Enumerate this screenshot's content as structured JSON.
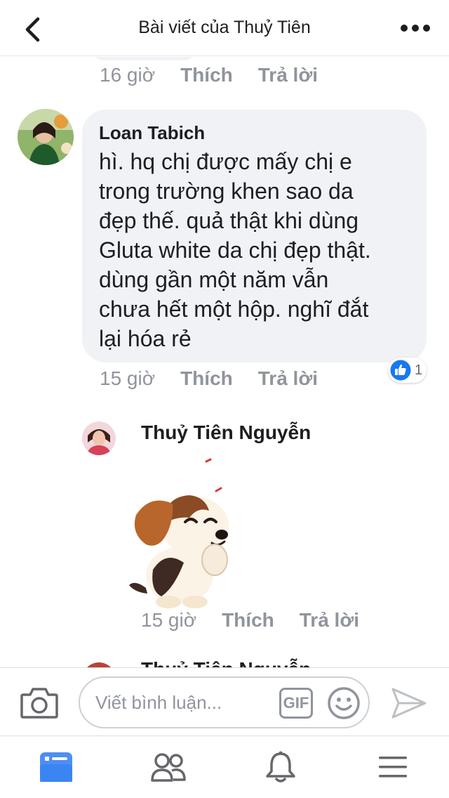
{
  "header": {
    "title": "Bài viết của Thuỷ Tiên"
  },
  "previous_comment": {
    "time": "16 giờ",
    "like_label": "Thích",
    "reply_label": "Trả lời"
  },
  "comment": {
    "author": "Loan Tabich",
    "text_lines": [
      "hì. hq chị được mấy chị e",
      "trong trường khen sao da",
      "đẹp thế. quả thật khi dùng",
      "Gluta white da chị đẹp thật.",
      "dùng gần một năm vẫn",
      "chưa hết một hộp. nghĩ đắt",
      "lại hóa rẻ"
    ],
    "time": "15 giờ",
    "like_label": "Thích",
    "reply_label": "Trả lời",
    "reaction_count": "1",
    "reaction_color": "#1877f2"
  },
  "reply": {
    "author": "Thuỷ Tiên Nguyễn",
    "time": "15 giờ",
    "like_label": "Thích",
    "reply_label": "Trả lời"
  },
  "composer": {
    "placeholder": "Viết bình luận...",
    "gif_label": "GIF"
  },
  "tabbar": {
    "items": [
      {
        "icon": "news-feed-icon",
        "active": true
      },
      {
        "icon": "friends-icon",
        "active": false
      },
      {
        "icon": "notifications-bell-icon",
        "active": false
      },
      {
        "icon": "menu-icon",
        "active": false
      }
    ]
  },
  "colors": {
    "accent": "#1877f2",
    "muted": "#90949c",
    "bubble": "#f0f2f5"
  }
}
